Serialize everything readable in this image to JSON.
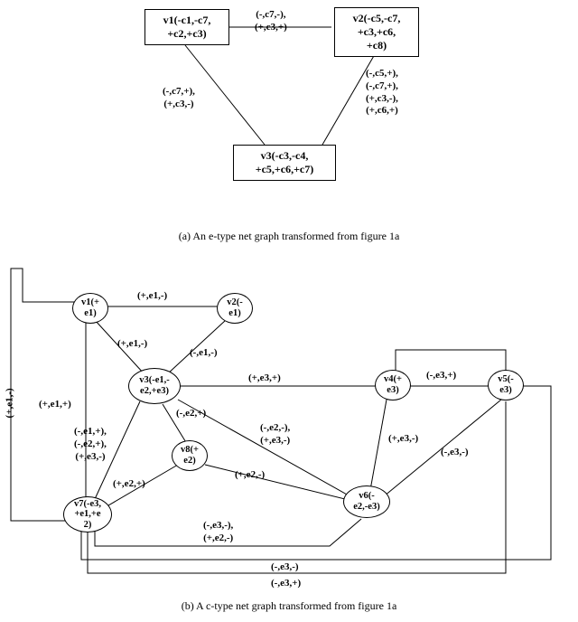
{
  "panel_a": {
    "nodes": {
      "v1": "v1(-c1,-c7,\n+c2,+c3)",
      "v2": "v2(-c5,-c7,\n+c3,+c6,\n+c8)",
      "v3": "v3(-c3,-c4,\n+c5,+c6,+c7)"
    },
    "edges": {
      "v1_v2": "(-,c7,-),\n(+,c3,+)",
      "v1_v3": "(-,c7,+),\n(+,c3,-)",
      "v2_v3": "(-,c5,+),\n(-,c7,+),\n(+,c3,-),\n(+,c6,+)"
    },
    "caption": "(a) An e-type net graph transformed from figure 1a"
  },
  "panel_b": {
    "nodes": {
      "v1": "v1(+\ne1)",
      "v2": "v2(-\ne1)",
      "v3": "v3(-e1,-\ne2,+e3)",
      "v4": "v4(+\ne3)",
      "v5": "v5(-\ne3)",
      "v6": "v6(-\ne2,-e3)",
      "v7": "v7(-e3,\n+e1,+e\n2)",
      "v8": "v8(+\ne2)"
    },
    "edges": {
      "v1_v2": "(+,e1,-)",
      "v1_v3": "(+,e1,-)",
      "v2_v3": "(-,e1,-)",
      "v1_v7": "(+,e1,+)",
      "v1_v7_outer": "(+,e1,-)",
      "v3_v4": "(+,e3,+)",
      "v4_v5": "(-,e3,+)",
      "v3_v8": "(-,e2,+)",
      "v8_v7": "(+,e2,+)",
      "v8_v6": "(+,e2,-)",
      "v3_v6": "(-,e2,-),\n(+,e3,-)",
      "v4_v6": "(+,e3,-)",
      "v5_v6": "(-,e3,-)",
      "v7_v6": "(-,e3,-),\n(+,e2,-)",
      "v3_v7": "(-,e1,+),\n(-,e2,+),\n(+,e3,-)",
      "v7_v5": "(-,e3,-)",
      "v7_v4": "(-,e3,+)"
    },
    "caption": "(b) A c-type net graph transformed from figure 1a"
  }
}
